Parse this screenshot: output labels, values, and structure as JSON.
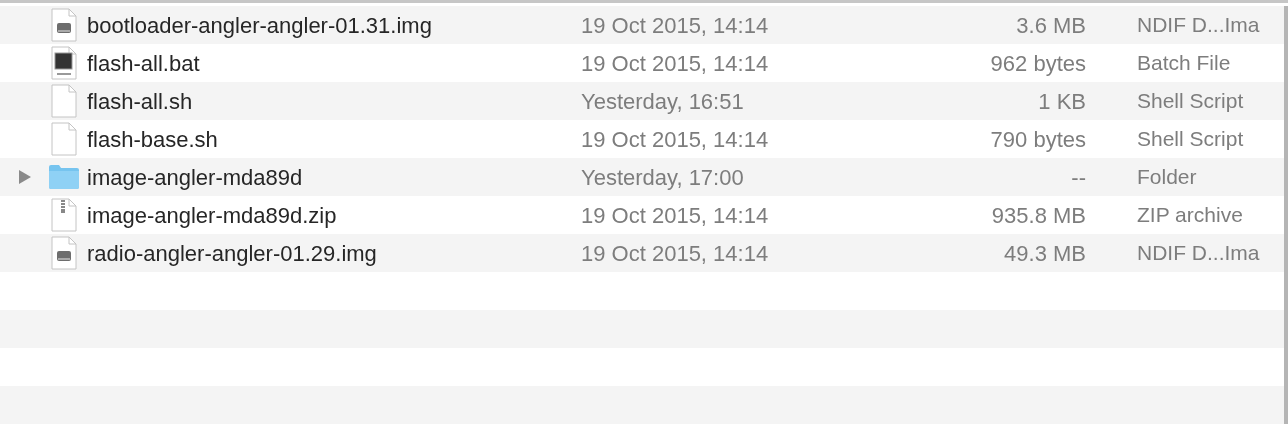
{
  "files": [
    {
      "name": "bootloader-angler-angler-01.31.img",
      "date": "19 Oct 2015, 14:14",
      "size": "3.6 MB",
      "type": "NDIF D...Ima",
      "kind": "disk-image"
    },
    {
      "name": "flash-all.bat",
      "date": "19 Oct 2015, 14:14",
      "size": "962 bytes",
      "type": "Batch File",
      "kind": "batch"
    },
    {
      "name": "flash-all.sh",
      "date": "Yesterday, 16:51",
      "size": "1 KB",
      "type": "Shell Script",
      "kind": "document"
    },
    {
      "name": "flash-base.sh",
      "date": "19 Oct 2015, 14:14",
      "size": "790 bytes",
      "type": "Shell Script",
      "kind": "document"
    },
    {
      "name": "image-angler-mda89d",
      "date": "Yesterday, 17:00",
      "size": "--",
      "type": "Folder",
      "kind": "folder",
      "expanded": false
    },
    {
      "name": "image-angler-mda89d.zip",
      "date": "19 Oct 2015, 14:14",
      "size": "935.8 MB",
      "type": "ZIP archive",
      "kind": "zip"
    },
    {
      "name": "radio-angler-angler-01.29.img",
      "date": "19 Oct 2015, 14:14",
      "size": "49.3 MB",
      "type": "NDIF D...Ima",
      "kind": "disk-image"
    }
  ]
}
